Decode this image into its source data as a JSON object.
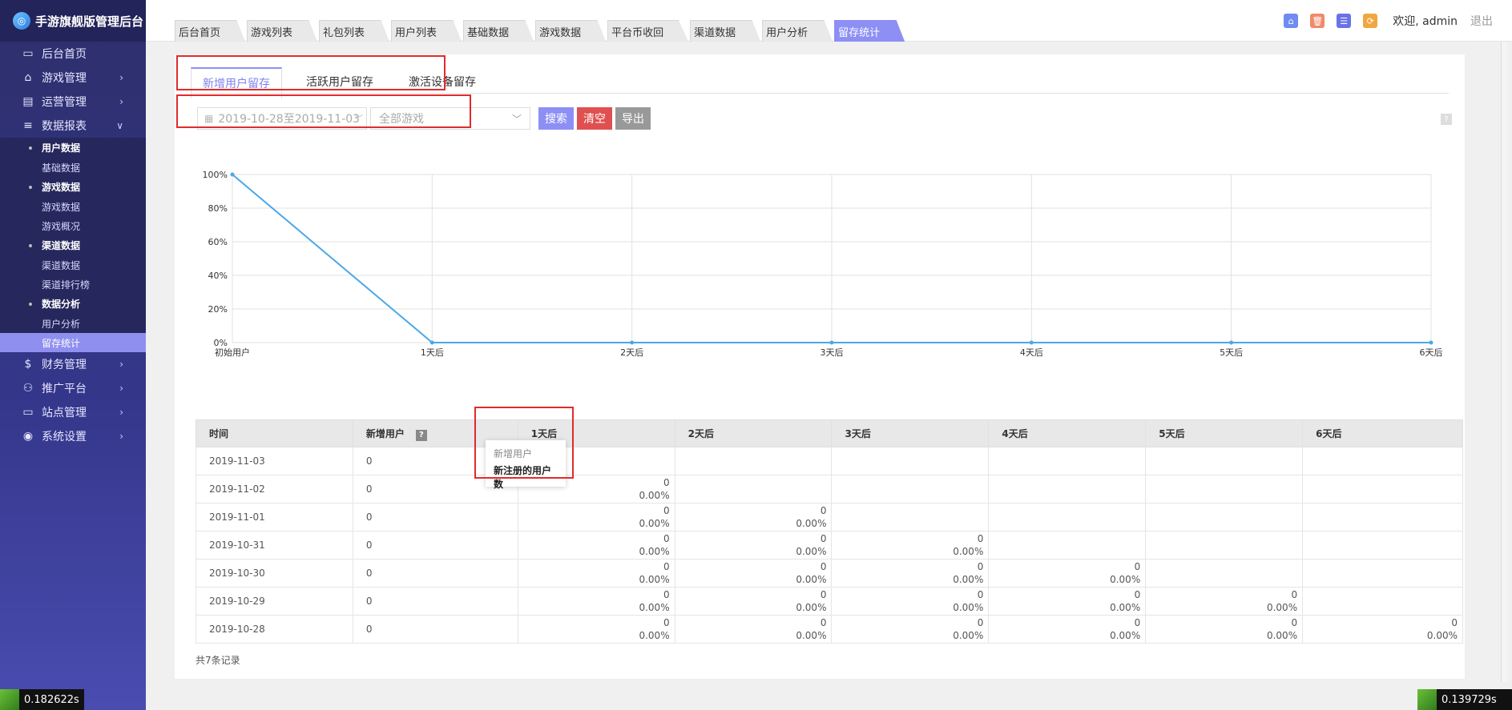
{
  "app": {
    "title": "手游旗舰版管理后台"
  },
  "sidebar": {
    "items": [
      {
        "label": "后台首页",
        "icon": "monitor-icon"
      },
      {
        "label": "游戏管理",
        "icon": "gamepad-icon"
      },
      {
        "label": "运营管理",
        "icon": "report-icon"
      },
      {
        "label": "数据报表",
        "icon": "database-icon"
      }
    ],
    "subgroups": [
      {
        "head": "用户数据",
        "items": [
          "基础数据"
        ]
      },
      {
        "head": "游戏数据",
        "items": [
          "游戏数据",
          "游戏概况"
        ]
      },
      {
        "head": "渠道数据",
        "items": [
          "渠道数据",
          "渠道排行榜"
        ]
      },
      {
        "head": "数据分析",
        "items": [
          "用户分析",
          "留存统计"
        ]
      }
    ],
    "after_items": [
      {
        "label": "财务管理",
        "icon": "dollar-icon"
      },
      {
        "label": "推广平台",
        "icon": "handshake-icon"
      },
      {
        "label": "站点管理",
        "icon": "monitor-icon"
      },
      {
        "label": "系统设置",
        "icon": "user-icon"
      }
    ],
    "active_item": "留存统计",
    "timer": "0.182622s"
  },
  "topbar": {
    "tabs": [
      "后台首页",
      "游戏列表",
      "礼包列表",
      "用户列表",
      "基础数据",
      "游戏数据",
      "平台币收回",
      "渠道数据",
      "用户分析",
      "留存统计"
    ],
    "active_tab": "留存统计",
    "welcome": "欢迎, admin",
    "logout": "退出",
    "icons": [
      "home-icon",
      "trash-icon",
      "list-icon",
      "refresh-icon"
    ]
  },
  "panel": {
    "tabs": [
      "新增用户留存",
      "活跃用户留存",
      "激活设备留存"
    ],
    "active_tab": "新增用户留存"
  },
  "filter": {
    "date_range": "2019-10-28至2019-11-03",
    "game_select": "全部游戏",
    "search_label": "搜索",
    "clear_label": "清空",
    "export_label": "导出",
    "help": "?"
  },
  "chart_data": {
    "type": "line",
    "categories": [
      "初始用户",
      "1天后",
      "2天后",
      "3天后",
      "4天后",
      "5天后",
      "6天后"
    ],
    "series": [
      {
        "values": [
          100,
          0,
          0,
          0,
          0,
          0,
          0
        ]
      }
    ],
    "yticks": [
      "0%",
      "20%",
      "40%",
      "60%",
      "80%",
      "100%"
    ],
    "ylim": [
      0,
      100
    ],
    "grid": true,
    "color": "#4aa8e8"
  },
  "table": {
    "headers": [
      "时间",
      "新增用户",
      "1天后",
      "2天后",
      "3天后",
      "4天后",
      "5天后",
      "6天后"
    ],
    "rows": [
      {
        "date": "2019-11-03",
        "new": "0",
        "cells": []
      },
      {
        "date": "2019-11-02",
        "new": "0",
        "cells": [
          [
            "0",
            "0.00%"
          ]
        ]
      },
      {
        "date": "2019-11-01",
        "new": "0",
        "cells": [
          [
            "0",
            "0.00%"
          ],
          [
            "0",
            "0.00%"
          ]
        ]
      },
      {
        "date": "2019-10-31",
        "new": "0",
        "cells": [
          [
            "0",
            "0.00%"
          ],
          [
            "0",
            "0.00%"
          ],
          [
            "0",
            "0.00%"
          ]
        ]
      },
      {
        "date": "2019-10-30",
        "new": "0",
        "cells": [
          [
            "0",
            "0.00%"
          ],
          [
            "0",
            "0.00%"
          ],
          [
            "0",
            "0.00%"
          ],
          [
            "0",
            "0.00%"
          ]
        ]
      },
      {
        "date": "2019-10-29",
        "new": "0",
        "cells": [
          [
            "0",
            "0.00%"
          ],
          [
            "0",
            "0.00%"
          ],
          [
            "0",
            "0.00%"
          ],
          [
            "0",
            "0.00%"
          ],
          [
            "0",
            "0.00%"
          ]
        ]
      },
      {
        "date": "2019-10-28",
        "new": "0",
        "cells": [
          [
            "0",
            "0.00%"
          ],
          [
            "0",
            "0.00%"
          ],
          [
            "0",
            "0.00%"
          ],
          [
            "0",
            "0.00%"
          ],
          [
            "0",
            "0.00%"
          ],
          [
            "0",
            "0.00%"
          ]
        ]
      }
    ],
    "records": "共7条记录",
    "tooltip_title": "新增用户",
    "tooltip_body": "新注册的用户数"
  },
  "footer": {
    "timer_right": "0.139729s"
  }
}
